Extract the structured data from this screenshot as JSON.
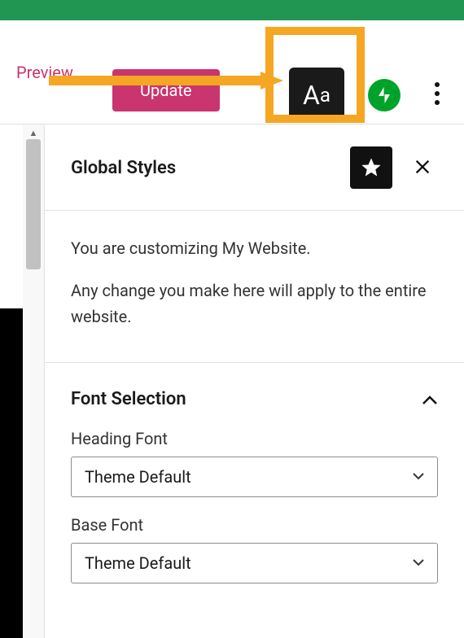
{
  "toolbar": {
    "preview_label": "Preview",
    "update_label": "Update",
    "aa_button_label": "Aa"
  },
  "panel": {
    "title": "Global Styles",
    "desc_line1": "You are customizing My Website.",
    "desc_line2": "Any change you make here will apply to the entire website."
  },
  "accordion": {
    "font_selection": {
      "title": "Font Selection",
      "heading_font": {
        "label": "Heading Font",
        "value": "Theme Default"
      },
      "base_font": {
        "label": "Base Font",
        "value": "Theme Default"
      }
    }
  },
  "icons": {
    "star": "star-icon",
    "close": "close-icon",
    "jetpack": "jetpack-icon",
    "more": "more-icon",
    "chevron_up": "chevron-up-icon",
    "chevron_down": "chevron-down-icon"
  }
}
